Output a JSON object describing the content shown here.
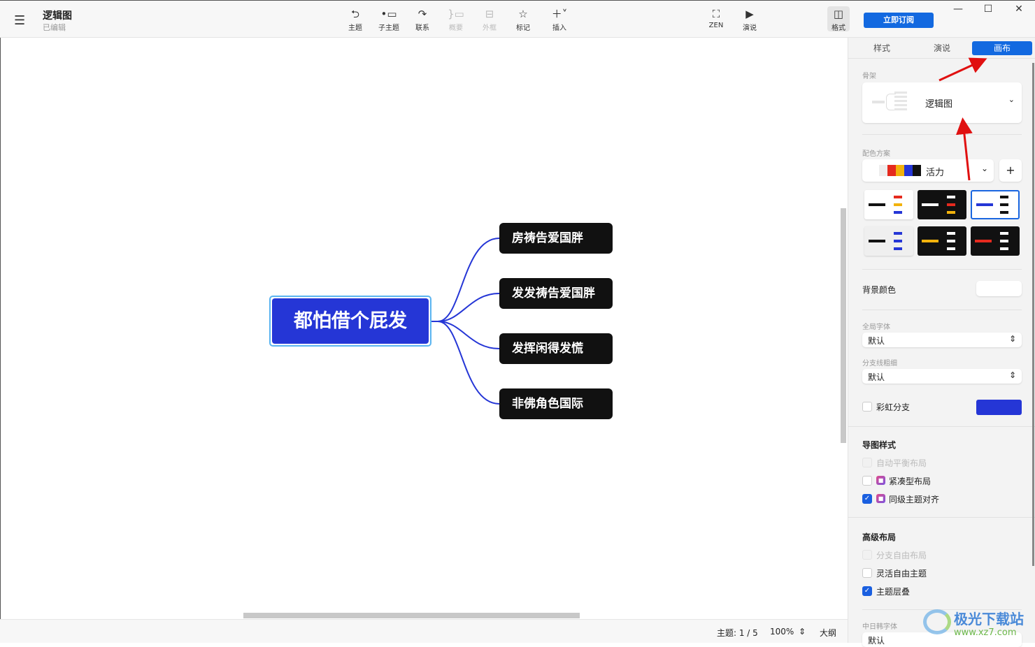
{
  "header": {
    "title": "逻辑图",
    "subtitle": "已编辑"
  },
  "toolbar": [
    {
      "label": "主题",
      "icon": "topic-icon"
    },
    {
      "label": "子主题",
      "icon": "subtopic-icon"
    },
    {
      "label": "联系",
      "icon": "relationship-icon"
    },
    {
      "label": "概要",
      "icon": "summary-icon"
    },
    {
      "label": "外框",
      "icon": "boundary-icon"
    },
    {
      "label": "标记",
      "icon": "star-icon"
    },
    {
      "label": "插入",
      "icon": "plus-icon"
    }
  ],
  "right_toolbar": {
    "zen": "ZEN",
    "present": "演说",
    "format": "格式",
    "subscribe": "立即订阅"
  },
  "map": {
    "central": "都怕借个屁发",
    "children": [
      "房祷告爱国胖",
      "发发祷告爱国胖",
      "发挥闲得发慌",
      "非佛角色国际"
    ],
    "accent": "#2536d6"
  },
  "status": {
    "topics": "主题: 1 / 5",
    "zoom": "100%",
    "outline": "大纲"
  },
  "panel": {
    "tabs": [
      "样式",
      "演说",
      "画布"
    ],
    "skeleton_label": "骨架",
    "skeleton_value": "逻辑图",
    "scheme_label": "配色方案",
    "scheme_value": "活力",
    "scheme_colors": [
      "#eeeeee",
      "#e52a1e",
      "#f2b20c",
      "#2536d6",
      "#111111"
    ],
    "bg_label": "背景颜色",
    "font_label": "全局字体",
    "font_value": "默认",
    "line_label": "分支线粗细",
    "line_value": "默认",
    "rainbow_label": "彩虹分支",
    "branch_color": "#2536d6",
    "map_style_title": "导图样式",
    "map_style": [
      {
        "label": "自动平衡布局",
        "checked": false,
        "disabled": true
      },
      {
        "label": "紧凑型布局",
        "checked": false,
        "locked": true
      },
      {
        "label": "同级主题对齐",
        "checked": true,
        "locked": true
      }
    ],
    "adv_title": "高级布局",
    "adv": [
      {
        "label": "分支自由布局",
        "checked": false,
        "disabled": true
      },
      {
        "label": "灵活自由主题",
        "checked": false
      },
      {
        "label": "主题层叠",
        "checked": true
      }
    ],
    "cjk_label": "中日韩字体",
    "cjk_value": "默认"
  },
  "watermark": {
    "name": "极光下载站",
    "url": "www.xz7.com"
  }
}
